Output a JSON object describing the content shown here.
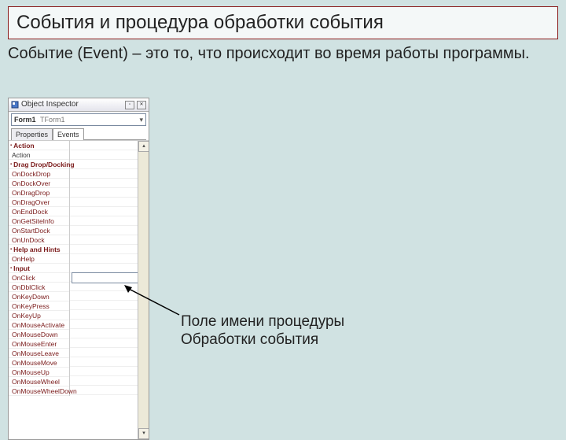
{
  "title": "События и процедура обработки события",
  "subtitle": "Событие (Event) – это то, что происходит во время работы программы.",
  "inspector": {
    "window_title": "Object Inspector",
    "combo_name": "Form1",
    "combo_type": "TForm1",
    "tabs": {
      "properties": "Properties",
      "events": "Events"
    },
    "groups": {
      "action": {
        "header": "Action",
        "items": [
          "Action"
        ]
      },
      "drag": {
        "header": "Drag Drop/Docking",
        "items": [
          "OnDockDrop",
          "OnDockOver",
          "OnDragDrop",
          "OnDragOver",
          "OnEndDock",
          "OnGetSiteInfo",
          "OnStartDock",
          "OnUnDock"
        ]
      },
      "help": {
        "header": "Help and Hints",
        "items": [
          "OnHelp"
        ]
      },
      "input": {
        "header": "Input",
        "items": [
          "OnClick",
          "OnDblClick",
          "OnKeyDown",
          "OnKeyPress",
          "OnKeyUp",
          "OnMouseActivate",
          "OnMouseDown",
          "OnMouseEnter",
          "OnMouseLeave",
          "OnMouseMove",
          "OnMouseUp",
          "OnMouseWheel",
          "OnMouseWheelDown"
        ]
      }
    },
    "selected_event": "OnClick"
  },
  "callout": {
    "line1": "Поле имени процедуры",
    "line2": "Обработки события"
  },
  "icons": {
    "app": "app-icon",
    "restore": "restore-icon",
    "close": "close-icon",
    "chevron_down": "chevron-down-icon",
    "scroll_up": "scroll-up-icon",
    "scroll_down": "scroll-down-icon"
  }
}
